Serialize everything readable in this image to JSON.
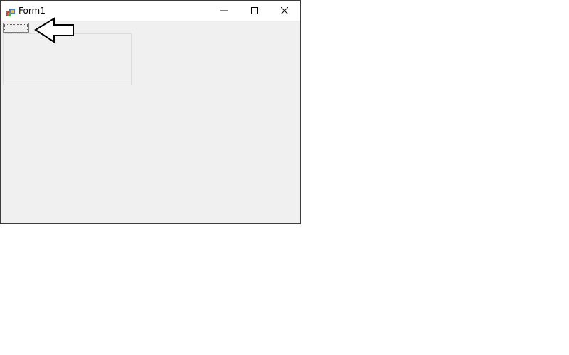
{
  "window": {
    "title": "Form1",
    "app_icon": "winforms-app-icon",
    "controls": {
      "minimize_icon": "minimize-icon",
      "maximize_icon": "maximize-icon",
      "close_icon": "close-icon"
    }
  },
  "annotation": {
    "arrow_icon": "left-arrow-icon"
  }
}
